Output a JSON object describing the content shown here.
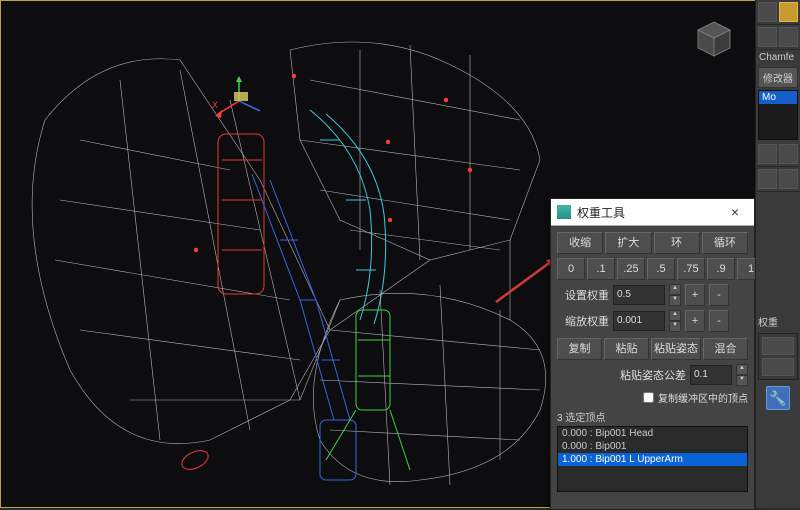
{
  "right_panel": {
    "tabs": [
      "",
      "",
      "",
      "",
      ""
    ],
    "modifier_label": "Chamfe",
    "modifier_group": "修改器",
    "modifier_stack": "Mo",
    "lower_label": "权重",
    "tool_icon": "wrench-icon"
  },
  "axis_limit": "Z",
  "dialog": {
    "title": "权重工具",
    "close": "×",
    "row1": {
      "shrink": "收缩",
      "grow": "扩大",
      "ring": "环",
      "loop": "循环"
    },
    "presets": [
      "0",
      ".1",
      ".25",
      ".5",
      ".75",
      ".9",
      "1"
    ],
    "set_weight_label": "设置权重",
    "set_weight_value": "0.5",
    "scale_weight_label": "缩放权重",
    "scale_weight_value": "0.001",
    "plus": "+",
    "minus": "-",
    "row_ops": {
      "copy": "复制",
      "paste": "粘贴",
      "paste_pose": "粘贴姿态",
      "blend": "混合"
    },
    "tol_label": "粘贴姿态公差",
    "tol_value": "0.1",
    "buffer_chk_label": "复制缓冲区中的顶点",
    "sel_verts_count": "3",
    "sel_verts_label": "选定顶点",
    "vert_list": [
      "0.000 : Bip001 Head",
      "0.000 : Bip001",
      "1.000 : Bip001 L UpperArm"
    ]
  },
  "colors": {
    "arrow": "#d23a3a",
    "sel": "#0a63d6"
  }
}
